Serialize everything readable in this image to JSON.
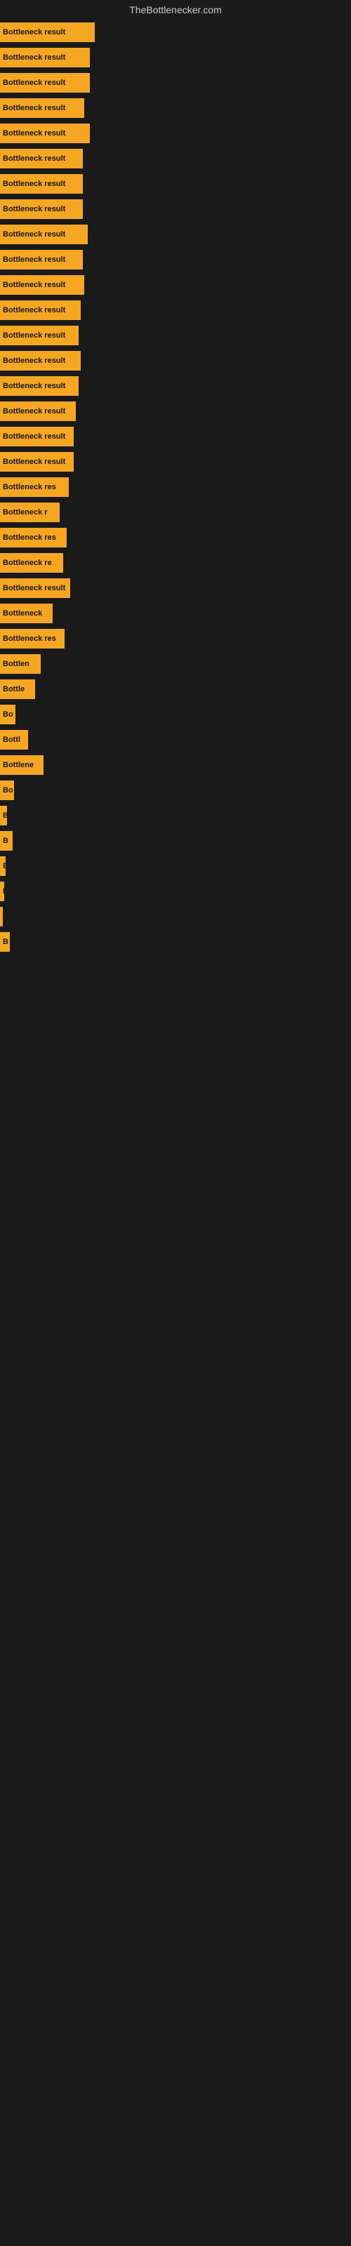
{
  "site": {
    "title": "TheBottlenecker.com"
  },
  "bars": [
    {
      "label": "Bottleneck result",
      "width": 135
    },
    {
      "label": "Bottleneck result",
      "width": 128
    },
    {
      "label": "Bottleneck result",
      "width": 128
    },
    {
      "label": "Bottleneck result",
      "width": 120
    },
    {
      "label": "Bottleneck result",
      "width": 128
    },
    {
      "label": "Bottleneck result",
      "width": 118
    },
    {
      "label": "Bottleneck result",
      "width": 118
    },
    {
      "label": "Bottleneck result",
      "width": 118
    },
    {
      "label": "Bottleneck result",
      "width": 125
    },
    {
      "label": "Bottleneck result",
      "width": 118
    },
    {
      "label": "Bottleneck result",
      "width": 120
    },
    {
      "label": "Bottleneck result",
      "width": 115
    },
    {
      "label": "Bottleneck result",
      "width": 112
    },
    {
      "label": "Bottleneck result",
      "width": 115
    },
    {
      "label": "Bottleneck result",
      "width": 112
    },
    {
      "label": "Bottleneck result",
      "width": 108
    },
    {
      "label": "Bottleneck result",
      "width": 105
    },
    {
      "label": "Bottleneck result",
      "width": 105
    },
    {
      "label": "Bottleneck res",
      "width": 98
    },
    {
      "label": "Bottleneck r",
      "width": 85
    },
    {
      "label": "Bottleneck res",
      "width": 95
    },
    {
      "label": "Bottleneck re",
      "width": 90
    },
    {
      "label": "Bottleneck result",
      "width": 100
    },
    {
      "label": "Bottleneck",
      "width": 75
    },
    {
      "label": "Bottleneck res",
      "width": 92
    },
    {
      "label": "Bottlen",
      "width": 58
    },
    {
      "label": "Bottle",
      "width": 50
    },
    {
      "label": "Bo",
      "width": 22
    },
    {
      "label": "Bottl",
      "width": 40
    },
    {
      "label": "Bottlene",
      "width": 62
    },
    {
      "label": "Bo",
      "width": 20
    },
    {
      "label": "B",
      "width": 10
    },
    {
      "label": "B",
      "width": 18
    },
    {
      "label": "B",
      "width": 8
    },
    {
      "label": "B",
      "width": 6
    },
    {
      "label": "",
      "width": 4
    },
    {
      "label": "B",
      "width": 14
    }
  ]
}
